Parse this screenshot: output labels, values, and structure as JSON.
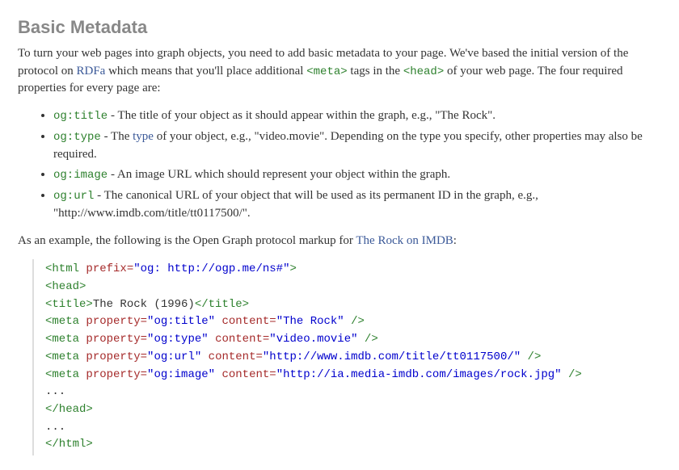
{
  "heading": "Basic Metadata",
  "intro": {
    "p1a": "To turn your web pages into graph objects, you need to add basic metadata to your page. We've based the initial version of the protocol on ",
    "rdfa": "RDFa",
    "p1b": " which means that you'll place additional ",
    "meta_tag": "<meta>",
    "p1c": " tags in the ",
    "head_tag": "<head>",
    "p1d": " of your web page. The four required properties for every page are:"
  },
  "props": [
    {
      "code": "og:title",
      "desc_a": " - The title of your object as it should appear within the graph, e.g., \"The Rock\"."
    },
    {
      "code": "og:type",
      "desc_a": " - The ",
      "link": "type",
      "desc_b": " of your object, e.g., \"video.movie\". Depending on the type you specify, other properties may also be required."
    },
    {
      "code": "og:image",
      "desc_a": " - An image URL which should represent your object within the graph."
    },
    {
      "code": "og:url",
      "desc_a": " - The canonical URL of your object that will be used as its permanent ID in the graph, e.g., \"http://www.imdb.com/title/tt0117500/\"."
    }
  ],
  "example_intro": {
    "a": "As an example, the following is the Open Graph protocol markup for ",
    "link": "The Rock on IMDB",
    "b": ":"
  },
  "code": {
    "l1_prefix_val": "\"og: http://ogp.me/ns#\"",
    "l3_title_text": "The Rock (1996)",
    "meta_rows": [
      {
        "prop": "\"og:title\"",
        "content": "\"The Rock\""
      },
      {
        "prop": "\"og:type\"",
        "content": "\"video.movie\""
      },
      {
        "prop": "\"og:url\"",
        "content": "\"http://www.imdb.com/title/tt0117500/\""
      },
      {
        "prop": "\"og:image\"",
        "content": "\"http://ia.media-imdb.com/images/rock.jpg\""
      }
    ],
    "tok": {
      "html_open": "<html ",
      "prefix_attr": "prefix=",
      "gt": ">",
      "head_open": "<head>",
      "title_open": "<title>",
      "title_close": "</title>",
      "meta_open": "<meta ",
      "property_attr": "property=",
      "content_attr": "content=",
      "self_close": " />",
      "dots": "...",
      "head_close": "</head>",
      "html_close": "</html>"
    }
  }
}
